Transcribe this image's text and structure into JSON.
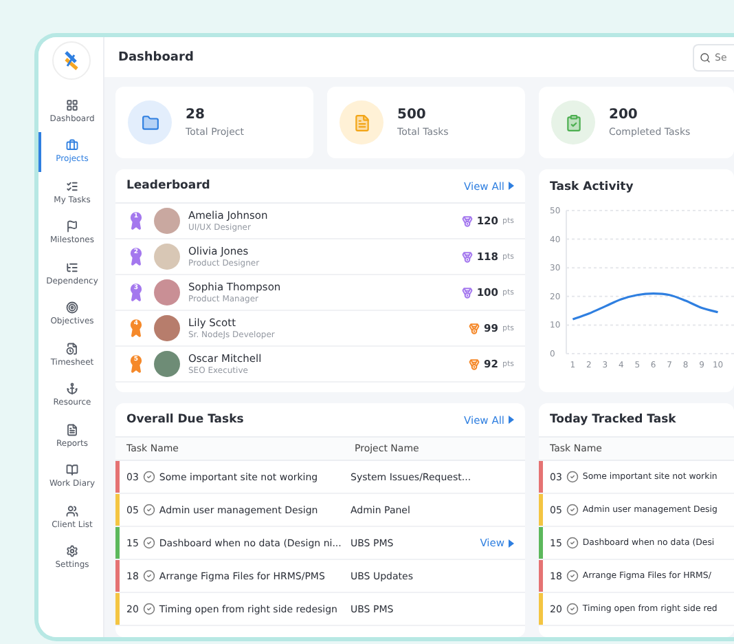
{
  "sidebar": {
    "items": [
      {
        "label": "Dashboard",
        "selected": false
      },
      {
        "label": "Projects",
        "selected": true
      },
      {
        "label": "My Tasks",
        "selected": false
      },
      {
        "label": "Milestones",
        "selected": false
      },
      {
        "label": "Dependency",
        "selected": false
      },
      {
        "label": "Objectives",
        "selected": false
      },
      {
        "label": "Timesheet",
        "selected": false
      },
      {
        "label": "Resource",
        "selected": false
      },
      {
        "label": "Reports",
        "selected": false
      },
      {
        "label": "Work Diary",
        "selected": false
      },
      {
        "label": "Client List",
        "selected": false
      },
      {
        "label": "Settings",
        "selected": false
      }
    ]
  },
  "header": {
    "title": "Dashboard",
    "search": {
      "placeholder": "Se"
    }
  },
  "stats": [
    {
      "kind": "projects",
      "value": "28",
      "label": "Total Project"
    },
    {
      "kind": "tasks",
      "value": "500",
      "label": "Total Tasks"
    },
    {
      "kind": "completed",
      "value": "200",
      "label": "Completed Tasks"
    }
  ],
  "leaderboard": {
    "title": "Leaderboard",
    "link": "View All",
    "rows": [
      {
        "rank": "1",
        "color": "#a478ee",
        "name": "Amelia Johnson",
        "role": "UI/UX Designer",
        "points": "120",
        "unit": "pts"
      },
      {
        "rank": "2",
        "color": "#a478ee",
        "name": "Olivia Jones",
        "role": "Product Designer",
        "points": "118",
        "unit": "pts"
      },
      {
        "rank": "3",
        "color": "#a478ee",
        "name": "Sophia Thompson",
        "role": "Product Manager",
        "points": "100",
        "unit": "pts"
      },
      {
        "rank": "4",
        "color": "#f5892a",
        "name": "Lily Scott",
        "role": "Sr. NodeJs Developer",
        "points": "99",
        "unit": "pts"
      },
      {
        "rank": "5",
        "color": "#f5892a",
        "name": "Oscar Mitchell",
        "role": "SEO Executive",
        "points": "92",
        "unit": "pts"
      }
    ]
  },
  "task_activity": {
    "chart_data": {
      "type": "line",
      "title": "Task Activity",
      "x": [
        1,
        2,
        3,
        4,
        5,
        6,
        7,
        8,
        9,
        10
      ],
      "series": [
        {
          "color": "#2f7fe0",
          "values": [
            12,
            14,
            16.5,
            19,
            20.5,
            21,
            20.5,
            18.5,
            16,
            14.5
          ]
        }
      ],
      "xlim": [
        0.6,
        11
      ],
      "ylim": [
        0,
        50
      ],
      "grid": true,
      "yticks": [
        {
          "value": 0,
          "label": "0"
        },
        {
          "value": 10,
          "label": "10"
        },
        {
          "value": 20,
          "label": "20"
        },
        {
          "value": 30,
          "label": "30"
        },
        {
          "value": 40,
          "label": "40"
        },
        {
          "value": 50,
          "label": "50"
        }
      ],
      "xticks": [
        1,
        2,
        3,
        4,
        5,
        6,
        7,
        8,
        9,
        10
      ]
    }
  },
  "due_tasks": {
    "title": "Overall Due Tasks",
    "link": "View All",
    "columns": [
      "Task Name",
      "Project Name"
    ],
    "rows": [
      {
        "id": "03",
        "name": "Some important site not working",
        "project": "System Issues/Request...",
        "color": "#e57373"
      },
      {
        "id": "05",
        "name": "Admin user management Design",
        "project": "Admin Panel",
        "color": "#f4c542"
      },
      {
        "id": "15",
        "name": "Dashboard when no data (Design ni...",
        "project": "UBS PMS",
        "color": "#5cb85c",
        "action": "View"
      },
      {
        "id": "18",
        "name": "Arrange Figma Files for HRMS/PMS",
        "project": "UBS Updates",
        "color": "#e57373"
      },
      {
        "id": "20",
        "name": "Timing open from right side redesign",
        "project": "UBS PMS",
        "color": "#f4c542"
      }
    ]
  },
  "tracked_tasks": {
    "title": "Today Tracked Task",
    "columns": [
      "Task Name"
    ],
    "rows": [
      {
        "id": "03",
        "name": "Some important site not workin",
        "color": "#e57373"
      },
      {
        "id": "05",
        "name": "Admin user management Desig",
        "color": "#f4c542"
      },
      {
        "id": "15",
        "name": "Dashboard when no data (Desi",
        "color": "#5cb85c"
      },
      {
        "id": "18",
        "name": "Arrange Figma Files for HRMS/",
        "color": "#e57373"
      },
      {
        "id": "20",
        "name": "Timing open from right side red",
        "color": "#f4c542"
      }
    ]
  }
}
